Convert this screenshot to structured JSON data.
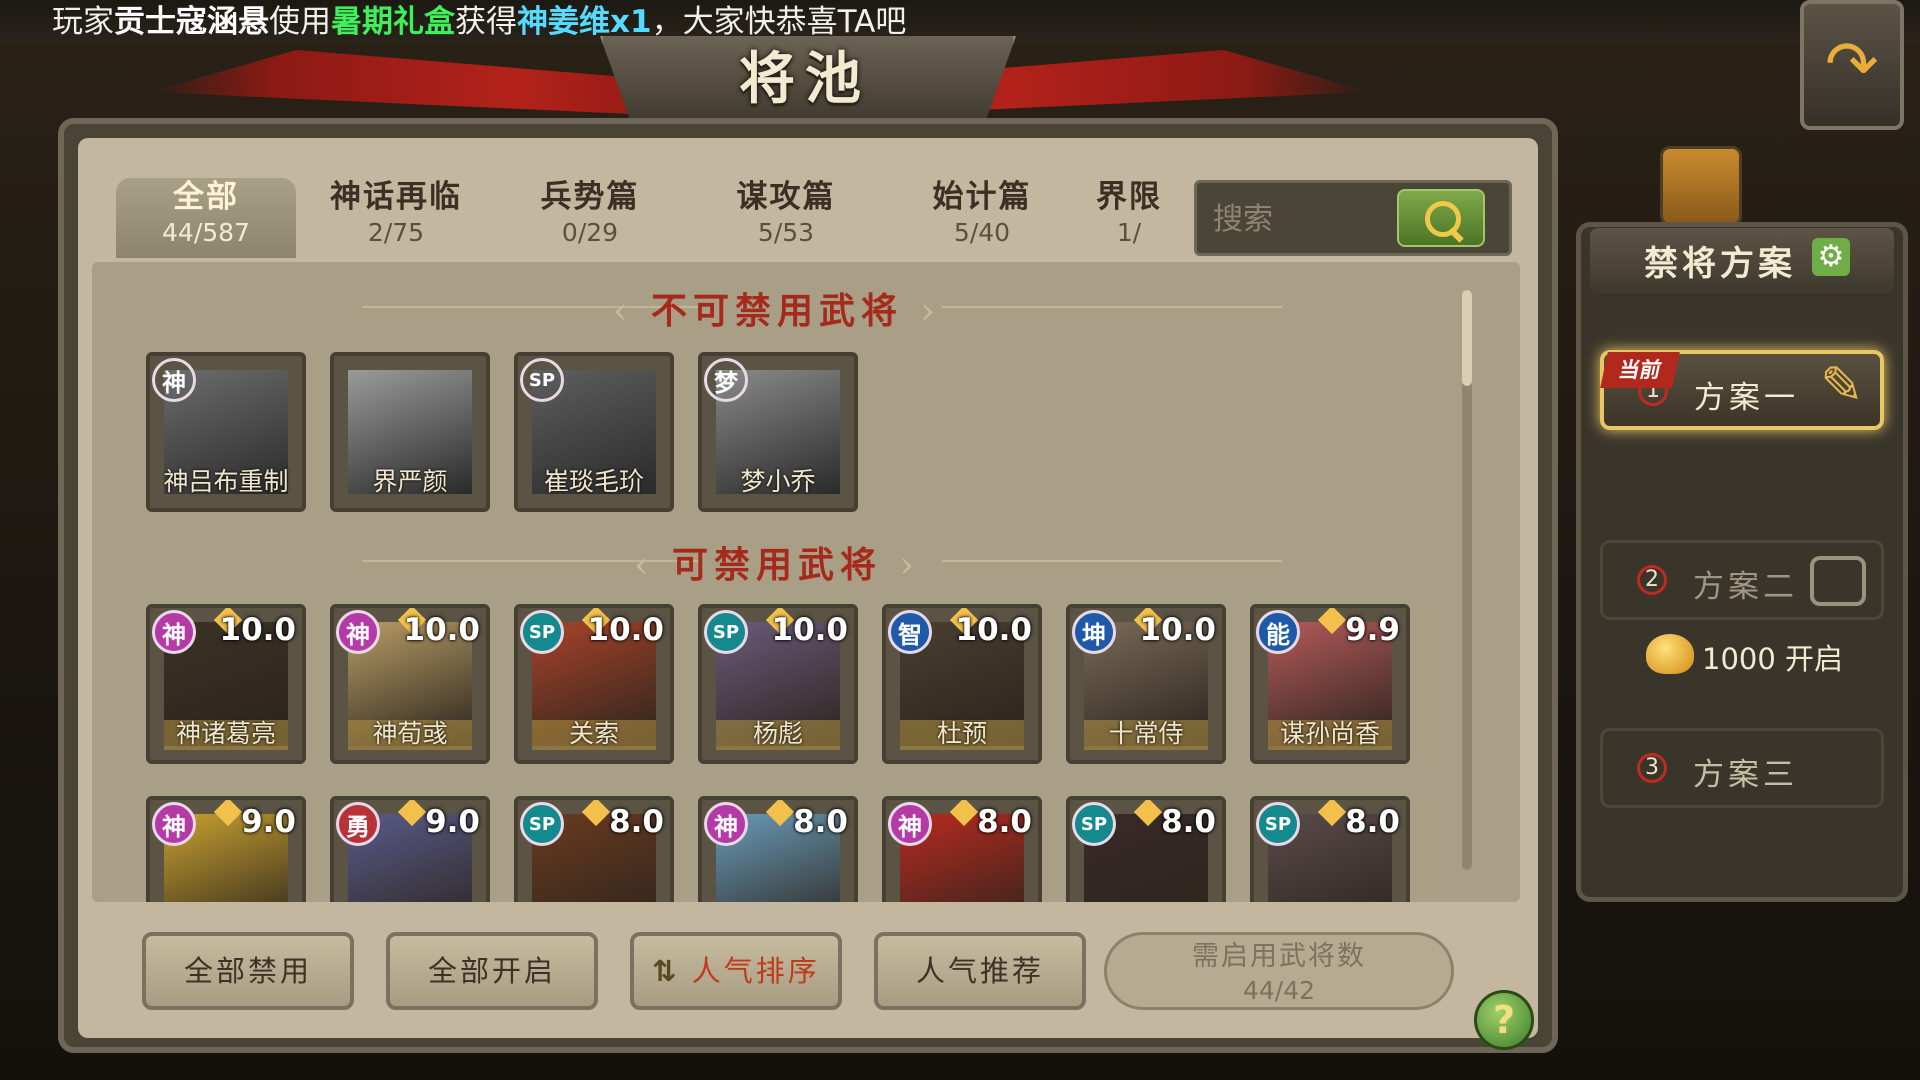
{
  "marquee": {
    "prefix": "玩家",
    "player": "贡士寇涵悬",
    "verb": "使用",
    "gift": "暑期礼盒",
    "get": "获得",
    "reward": "神姜维x1",
    "suffix": "，大家快恭喜TA吧"
  },
  "page": {
    "title": "将池"
  },
  "tabs": [
    {
      "label": "全部",
      "count": "44/587",
      "active": true
    },
    {
      "label": "神话再临",
      "count": "2/75"
    },
    {
      "label": "兵势篇",
      "count": "0/29"
    },
    {
      "label": "谋攻篇",
      "count": "5/53"
    },
    {
      "label": "始计篇",
      "count": "5/40"
    },
    {
      "label": "界限",
      "count": "1/"
    }
  ],
  "search": {
    "placeholder": "搜索"
  },
  "sections": {
    "cannot_ban": "不可禁用武将",
    "can_ban": "可禁用武将"
  },
  "unbannable": [
    {
      "badge": "神",
      "name": "神吕布重制",
      "badge_color": "#f4f4f4",
      "portrait": "#6c6c6c"
    },
    {
      "badge": "",
      "name": "界严颜",
      "badge_color": "",
      "portrait": "#9a9a9a"
    },
    {
      "badge": "SP",
      "name": "崔琰毛玠",
      "badge_color": "#f4f4f4",
      "portrait": "#5e5e5e"
    },
    {
      "badge": "梦",
      "name": "梦小乔",
      "badge_color": "#f4f4f4",
      "portrait": "#8a8a8a"
    }
  ],
  "bannable_row1": [
    {
      "badge": "神",
      "score": "10.0",
      "name": "神诸葛亮",
      "badge_color": "#b43aa5",
      "portrait": "#3c3226"
    },
    {
      "badge": "神",
      "score": "10.0",
      "name": "神荀彧",
      "badge_color": "#b43aa5",
      "portrait": "#b89c66"
    },
    {
      "badge": "SP",
      "score": "10.0",
      "name": "关索",
      "badge_color": "#148a8e",
      "portrait": "#a8432a"
    },
    {
      "badge": "SP",
      "score": "10.0",
      "name": "杨彪",
      "badge_color": "#148a8e",
      "portrait": "#6b5a7a"
    },
    {
      "badge": "智",
      "score": "10.0",
      "name": "杜预",
      "badge_color": "#1f5aa8",
      "portrait": "#4a3e30"
    },
    {
      "badge": "坤",
      "score": "10.0",
      "name": "十常侍",
      "badge_color": "#1f5aa8",
      "portrait": "#7a6a58"
    },
    {
      "badge": "能",
      "score": "9.9",
      "name": "谋孙尚香",
      "badge_color": "#1f5aa8",
      "portrait": "#b45a5a"
    }
  ],
  "bannable_row2": [
    {
      "badge": "神",
      "score": "9.0",
      "badge_color": "#b43aa5",
      "portrait": "#c8a030"
    },
    {
      "badge": "勇",
      "score": "9.0",
      "badge_color": "#b8323a",
      "portrait": "#5a5a8a"
    },
    {
      "badge": "SP",
      "score": "8.0",
      "badge_color": "#148a8e",
      "portrait": "#6a3a20"
    },
    {
      "badge": "神",
      "score": "8.0",
      "badge_color": "#b43aa5",
      "portrait": "#6a9ab8"
    },
    {
      "badge": "神",
      "score": "8.0",
      "badge_color": "#b43aa5",
      "portrait": "#b82a20"
    },
    {
      "badge": "SP",
      "score": "8.0",
      "badge_color": "#148a8e",
      "portrait": "#3a2a28"
    },
    {
      "badge": "SP",
      "score": "8.0",
      "badge_color": "#148a8e",
      "portrait": "#5a4a4a"
    }
  ],
  "bottom": {
    "ban_all": "全部禁用",
    "enable_all": "全部开启",
    "sort_popular": "人气排序",
    "recommend": "人气推荐",
    "required_label": "需启用武将数",
    "required_value": "44/42"
  },
  "schemes": {
    "title": "禁将方案",
    "current_tag": "当前",
    "items": [
      {
        "num": "1",
        "label": "方案一"
      },
      {
        "num": "2",
        "label": "方案二"
      },
      {
        "num": "3",
        "label": "方案三"
      }
    ],
    "unlock_cost": "1000 开启"
  },
  "icons": [
    "back-arrow-icon",
    "search-icon",
    "gear-icon",
    "edit-icon",
    "lock-icon",
    "gold-ingot-icon",
    "help-icon",
    "scroll-icon"
  ]
}
